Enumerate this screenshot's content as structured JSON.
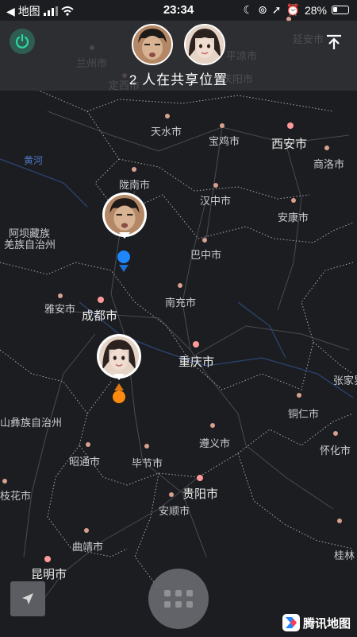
{
  "status_bar": {
    "back_app": "◀ 地图",
    "time": "23:34",
    "battery": "28%"
  },
  "header": {
    "share_label": "2 人在共享位置"
  },
  "map": {
    "cities": [
      {
        "name": "兰州市",
        "big": false
      },
      {
        "name": "定西市",
        "big": false
      },
      {
        "name": "天水市",
        "big": false
      },
      {
        "name": "宝鸡市",
        "big": false
      },
      {
        "name": "西安市",
        "big": true
      },
      {
        "name": "商洛市",
        "big": false
      },
      {
        "name": "陇南市",
        "big": false
      },
      {
        "name": "汉中市",
        "big": false
      },
      {
        "name": "安康市",
        "big": false
      },
      {
        "name": "阿坝藏族",
        "big": false
      },
      {
        "name": "羌族自治州",
        "big": false
      },
      {
        "name": "巴中市",
        "big": false
      },
      {
        "name": "雅安市",
        "big": false
      },
      {
        "name": "成都市",
        "big": true
      },
      {
        "name": "南充市",
        "big": false
      },
      {
        "name": "重庆市",
        "big": true
      },
      {
        "name": "张家界",
        "big": false
      },
      {
        "name": "山彝族自治州",
        "big": false
      },
      {
        "name": "铜仁市",
        "big": false
      },
      {
        "name": "遵义市",
        "big": false
      },
      {
        "name": "怀化市",
        "big": false
      },
      {
        "name": "昭通市",
        "big": false
      },
      {
        "name": "毕节市",
        "big": false
      },
      {
        "name": "贵阳市",
        "big": true
      },
      {
        "name": "安顺市",
        "big": false
      },
      {
        "name": "枝花市",
        "big": false
      },
      {
        "name": "曲靖市",
        "big": false
      },
      {
        "name": "桂林",
        "big": false
      },
      {
        "name": "昆明市",
        "big": true
      },
      {
        "name": "延安市",
        "big": false
      },
      {
        "name": "庆阳市",
        "big": false
      },
      {
        "name": "平凉市",
        "big": false
      },
      {
        "name": "黄河",
        "big": false,
        "river": true
      }
    ]
  },
  "brand": {
    "name": "腾讯地图"
  },
  "colors": {
    "accent_green": "#2fd6a1",
    "user_blue": "#1e86ff",
    "user_orange": "#ff8a10"
  },
  "icons": {
    "power": "power-icon",
    "collapse": "collapse-top-icon",
    "locate": "locate-arrow-icon",
    "menu": "grid-menu-icon"
  }
}
